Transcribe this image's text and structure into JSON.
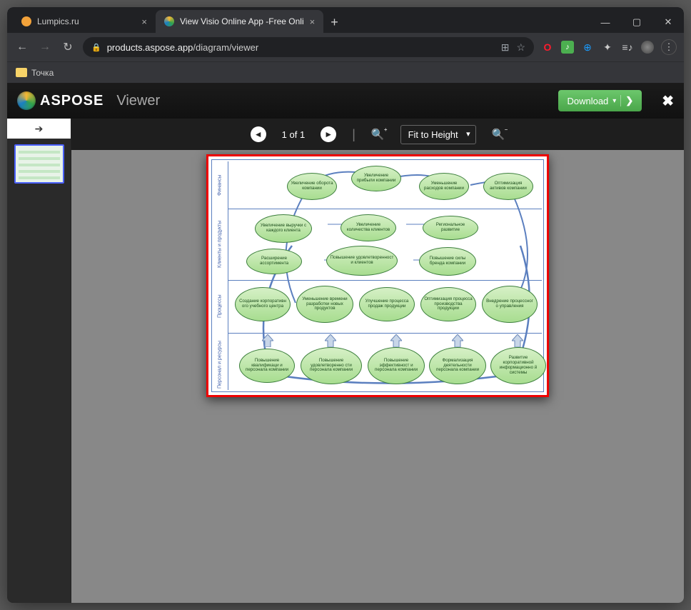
{
  "browser": {
    "tabs": [
      {
        "title": "Lumpics.ru",
        "favicon_color": "#f2a23a",
        "active": false
      },
      {
        "title": "View Visio Online App -Free Onli",
        "favicon_swirl": true,
        "active": true
      }
    ],
    "url_prefix": "products.aspose.app",
    "url_path": "/diagram/viewer",
    "bookmark": "Точка"
  },
  "app": {
    "brand": "ASPOSE",
    "section": "Viewer",
    "download_label": "Download",
    "fit_label": "Fit to Height",
    "page_indicator": "1 of 1"
  },
  "diagram": {
    "lanes": [
      "Финансы",
      "Клиенты и продукты",
      "Процессы",
      "Персонал и ресурсы"
    ],
    "row1": [
      "Увеличение оборота компании",
      "Увеличение прибыли компании",
      "Уменьшение расходов компании",
      "Оптимизация активов компании"
    ],
    "row2a": [
      "Увеличение выручки с каждого клиента",
      "Увеличение количества клиентов",
      "Региональное развитие"
    ],
    "row2b": [
      "Расширение ассортимента",
      "Повышение удовлетворенност и клиентов",
      "Повышение силы бренда компании"
    ],
    "row3": [
      "Создание корпоративн ого учебного центра",
      "Уменьшение времени разработки новых продуктов",
      "Улучшение процесса продаж продукции",
      "Оптимизация процесса производства продукции",
      "Внедрение процессног о управления"
    ],
    "row4": [
      "Повышение квалификаци и персонала компании",
      "Повышение удовлетворенно сти персонала компании",
      "Повышение эффективност и персонала компании",
      "Формализация деятельности персонала компании",
      "Развитие корпоративной информационно й системы"
    ]
  }
}
